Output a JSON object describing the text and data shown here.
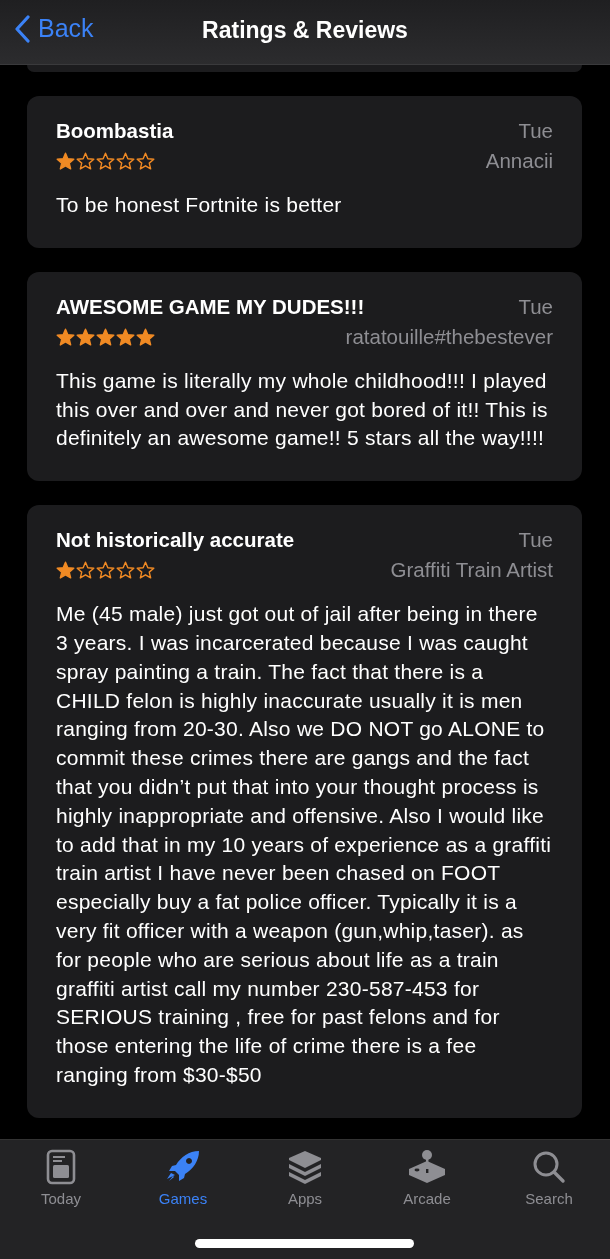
{
  "header": {
    "back": "Back",
    "title": "Ratings & Reviews"
  },
  "reviews": [
    {
      "title": "Boombastia",
      "date": "Tue",
      "author": "Annacii",
      "stars": 1,
      "body": "To be honest Fortnite is better"
    },
    {
      "title": "AWESOME GAME MY DUDES!!!",
      "date": "Tue",
      "author": "ratatouille#thebestever",
      "stars": 5,
      "body": "This game is literally my whole childhood!!! I played this over and over and never got bored of it!! This is definitely an awesome game!! 5 stars all the way!!!!"
    },
    {
      "title": "Not historically accurate",
      "date": "Tue",
      "author": "Graffiti Train Artist",
      "stars": 1,
      "body": "Me (45 male) just got out of jail after being in there 3 years. I was incarcerated because I was caught spray painting a train. The fact that there is a CHILD felon is highly inaccurate usually it is men ranging from 20-30. Also we DO NOT go ALONE to commit these crimes there are gangs and the fact that you didn’t put that into your thought process is highly inappropriate and offensive. Also I would like to add that in my 10 years of experience as a graffiti train artist I have never been chased on FOOT especially buy a fat police officer. Typically it is a very fit officer with a weapon (gun,whip,taser). as for people who are serious about life as a train graffiti artist  call my number 230-587-453 for SERIOUS training , free for past felons and for those entering the life of crime there is a fee ranging from $30-$50"
    }
  ],
  "tab_bar": [
    {
      "kind": "today",
      "label": "Today",
      "selected": false
    },
    {
      "kind": "games",
      "label": "Games",
      "selected": true
    },
    {
      "kind": "apps",
      "label": "Apps",
      "selected": false
    },
    {
      "kind": "arcade",
      "label": "Arcade",
      "selected": false
    },
    {
      "kind": "search",
      "label": "Search",
      "selected": false
    }
  ]
}
